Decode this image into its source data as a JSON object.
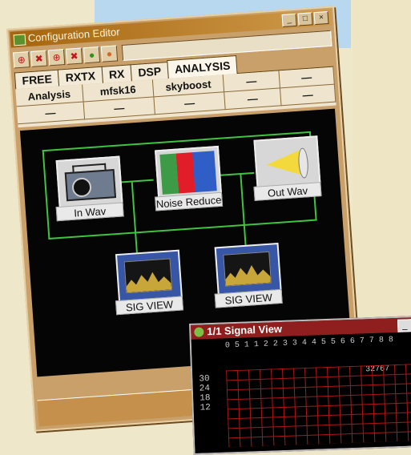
{
  "config_window": {
    "title": "Configuration Editor",
    "controls": {
      "minimize": "_",
      "maximize": "□",
      "close": "×"
    },
    "toolbar_icons": [
      "add-node-icon",
      "remove-node-icon",
      "add-node-icon",
      "remove-node-icon",
      "run-green-icon",
      "stop-orange-icon"
    ],
    "tabs": [
      "FREE",
      "RXTX",
      "RX",
      "DSP",
      "ANALYSIS"
    ],
    "active_tab": "ANALYSIS",
    "grid_row1": [
      "Analysis",
      "mfsk16",
      "skyboost",
      "—",
      "—"
    ],
    "grid_row2": [
      "—",
      "—",
      "—",
      "—",
      "—"
    ],
    "nodes": [
      {
        "label": "In Wav",
        "icon": "radio-icon"
      },
      {
        "label": "Noise Reduce",
        "icon": "noise-reduction-icon"
      },
      {
        "label": "Out Wav",
        "icon": "speaker-icon"
      },
      {
        "label": "SIG VIEW",
        "icon": "signal-view-icon"
      },
      {
        "label": "SIG VIEW",
        "icon": "signal-view-icon"
      }
    ]
  },
  "signal_window": {
    "title": "1/1 Signal View",
    "controls": {
      "minimize": "_",
      "close": "□"
    },
    "column_header": "0 5 1 1 2 2 3 3 4 4 5 5 6 6 7 7 8 8",
    "max_value": "32767",
    "y_labels": [
      "30",
      "24",
      "18",
      "12"
    ]
  },
  "colors": {
    "canvas": "#050505",
    "link": "#3fc43f",
    "title_bar": "#a5650e",
    "signal_grid": "#b01515"
  }
}
